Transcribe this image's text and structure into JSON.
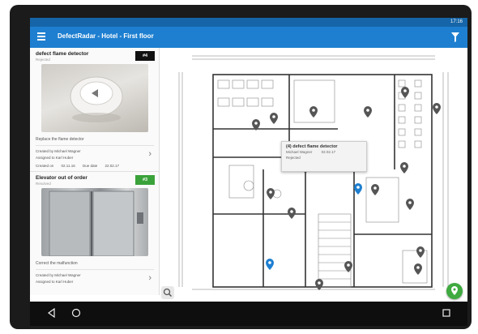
{
  "status_bar": {
    "time": "17:16"
  },
  "app_bar": {
    "title": "DefectRadar - Hotel - First floor",
    "filter_icon": "filter-icon",
    "menu_icon": "menu-icon"
  },
  "defects": [
    {
      "title": "defect flame detector",
      "status": "Rejected",
      "number": "#4",
      "badge_color": "#111111",
      "description": "Replace the flame detector",
      "created_by": "Created by Michael Wagner",
      "assigned_to": "Assigned to Karl Huber",
      "created_on_label": "Created on",
      "created_on": "02.11.16",
      "due_date_label": "Due date",
      "due_date": "22.02.17"
    },
    {
      "title": "Elevator out of order",
      "status": "Resolved",
      "number": "#3",
      "badge_color": "#3aa23a",
      "description": "Correct the malfunction",
      "created_by": "Created by Michael Wagner",
      "assigned_to": "Assigned to Karl Huber"
    }
  ],
  "popup": {
    "title": "(4) defect flame detector",
    "line1": "Michael Wagner",
    "date": "02.02.17",
    "line2": "Rejected"
  },
  "plan": {
    "pin_color": "#555555",
    "selected_pin_color": "#1e7fd0"
  },
  "fab": {
    "icon": "location-pin-icon",
    "color": "#3faa3f"
  },
  "zoom": {
    "icon": "zoom-icon"
  },
  "nav": {
    "back": "back-icon",
    "home": "home-icon",
    "recents": "recents-icon"
  }
}
